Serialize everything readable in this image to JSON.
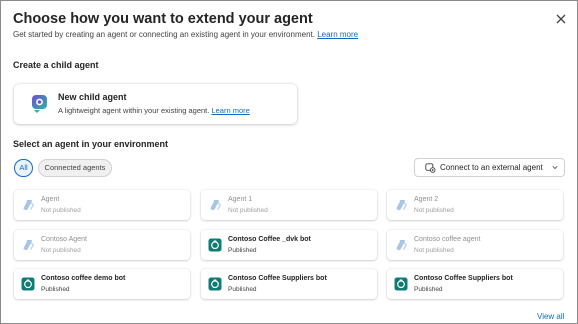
{
  "dialog": {
    "title": "Choose how you want to extend your agent",
    "subtitle": "Get started by creating an agent or connecting an existing agent in your environment.",
    "subtitle_link": "Learn more"
  },
  "child_section": {
    "heading": "Create a child agent",
    "card": {
      "title": "New child agent",
      "description": "A lightweight agent within your existing agent.",
      "link": "Learn more"
    }
  },
  "env_section": {
    "heading": "Select an agent in your environment",
    "filters": [
      "All",
      "Connected agents"
    ],
    "selected_filter": "All",
    "external_button": "Connect to an external agent"
  },
  "agents": [
    {
      "name": "Agent",
      "status": "Not published",
      "published": false
    },
    {
      "name": "Agent 1",
      "status": "Not published",
      "published": false
    },
    {
      "name": "Agent 2",
      "status": "Not published",
      "published": false
    },
    {
      "name": "Contoso Agent",
      "status": "Not published",
      "published": false
    },
    {
      "name": "Contoso Coffee _dvk bot",
      "status": "Published",
      "published": true
    },
    {
      "name": "Contoso coffee agent",
      "status": "Not published",
      "published": false
    },
    {
      "name": "Contoso coffee demo bot",
      "status": "Published",
      "published": true
    },
    {
      "name": "Contoso Coffee Suppliers bot",
      "status": "Published",
      "published": true
    },
    {
      "name": "Contoso Coffee Suppliers bot",
      "status": "Published",
      "published": true
    }
  ],
  "footer": {
    "view_all": "View all"
  },
  "colors": {
    "accent": "#0f6cbd",
    "published_icon": "#0e7c74",
    "unpublished_icon": "#a9c5e6"
  }
}
